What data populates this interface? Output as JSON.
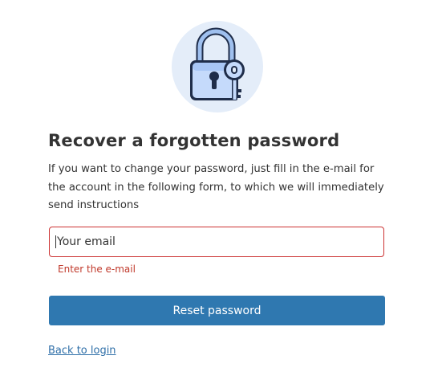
{
  "page": {
    "title": "Recover a forgotten password",
    "description": "If you want to change your password, just fill in the e-mail for the account in the following form, to which we will immediately send instructions"
  },
  "form": {
    "email_placeholder": "Your email",
    "email_value": "",
    "error_message": "Enter the e-mail",
    "submit_label": "Reset password",
    "back_link_label": "Back to login"
  },
  "icons": {
    "illustration": "padlock-with-key-icon"
  },
  "colors": {
    "primary_button": "#2f78b0",
    "error": "#c0392b",
    "error_border": "#cc3333",
    "link": "#2f6fa8",
    "illustration_bg": "#e4edf9"
  }
}
